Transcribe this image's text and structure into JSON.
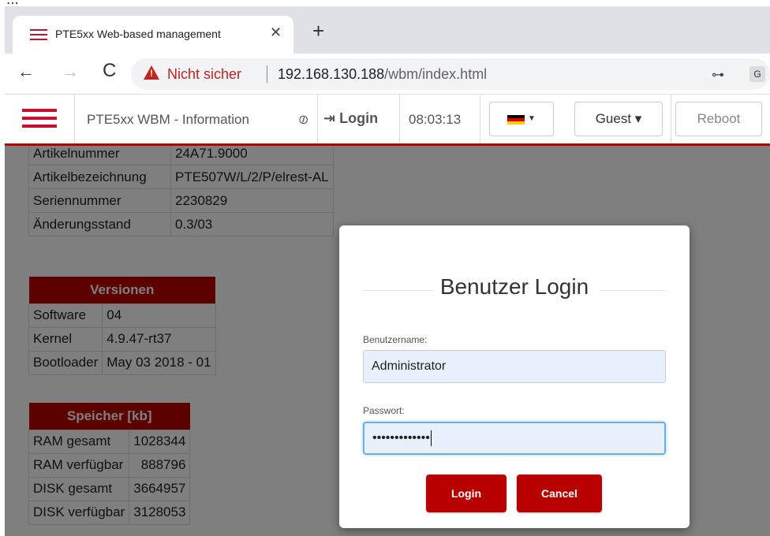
{
  "top_clip": "...",
  "browser": {
    "tab_title": "PTE5xx Web-based management",
    "tab_close": "✕",
    "new_tab": "+",
    "back": "←",
    "forward": "→",
    "reload": "C",
    "not_secure": "Nicht sicher",
    "url_host": "192.168.130.188",
    "url_path": "/wbm/index.html",
    "key_icon": "⊶",
    "translate_icon": "G"
  },
  "header": {
    "title": "PTE5xx WBM - Information",
    "unlink_icon": "⊘",
    "login_label": "Login",
    "login_icon": "⇥",
    "time": "08:03:13",
    "flag_colors": [
      "#000000",
      "#dd0000",
      "#ffce00"
    ],
    "guest_label": "Guest ▾",
    "reboot_label": "Reboot"
  },
  "device_table": {
    "rows": [
      [
        "Artikelnummer",
        "24A71.9000"
      ],
      [
        "Artikelbezeichnung",
        "PTE507W/L/2/P/elrest-AL"
      ],
      [
        "Seriennummer",
        "2230829"
      ],
      [
        "Änderungsstand",
        "0.3/03"
      ]
    ]
  },
  "versions_table": {
    "title": "Versionen",
    "rows": [
      [
        "Software",
        "04"
      ],
      [
        "Kernel",
        "4.9.47-rt37"
      ],
      [
        "Bootloader",
        "May 03 2018 - 01"
      ]
    ]
  },
  "memory_table": {
    "title": "Speicher [kb]",
    "rows": [
      [
        "RAM gesamt",
        "1028344"
      ],
      [
        "RAM verfügbar",
        "888796"
      ],
      [
        "DISK gesamt",
        "3664957"
      ],
      [
        "DISK verfügbar",
        "3128053"
      ]
    ]
  },
  "login_modal": {
    "title": "Benutzer Login",
    "username_label": "Benutzername:",
    "username_value": "Administrator",
    "password_label": "Passwort:",
    "password_mask": "•••••••••••••",
    "login_button": "Login",
    "cancel_button": "Cancel"
  },
  "colors": {
    "brand_red": "#b80000",
    "overlay": "rgba(0,0,0,0.5)",
    "not_secure_red": "#c5221f"
  }
}
